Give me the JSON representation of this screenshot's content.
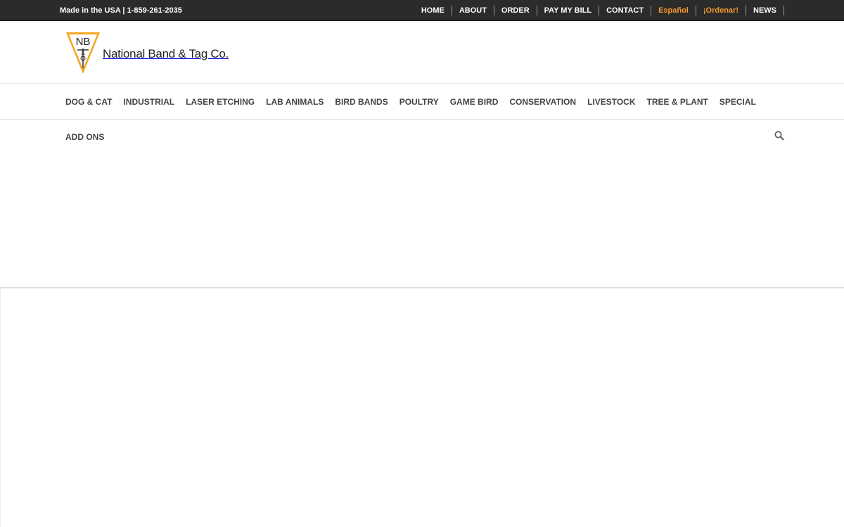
{
  "topbar": {
    "tagline": "Made in the USA | 1-859-261-2035",
    "links": [
      {
        "label": "HOME"
      },
      {
        "label": "ABOUT"
      },
      {
        "label": "ORDER"
      },
      {
        "label": "PAY MY BILL"
      },
      {
        "label": "CONTACT"
      },
      {
        "label": "Español"
      },
      {
        "label": "¡Ordenar!"
      },
      {
        "label": "NEWS"
      }
    ]
  },
  "logo": {
    "monogram_top": "NB",
    "monogram_mid": "&",
    "monogram_bottom": "T",
    "name": "National Band & Tag Co."
  },
  "main_nav": {
    "items": [
      {
        "label": "DOG & CAT"
      },
      {
        "label": "INDUSTRIAL"
      },
      {
        "label": "LASER ETCHING"
      },
      {
        "label": "LAB ANIMALS"
      },
      {
        "label": "BIRD BANDS"
      },
      {
        "label": "POULTRY"
      },
      {
        "label": "GAME BIRD"
      },
      {
        "label": "CONSERVATION"
      },
      {
        "label": "LIVESTOCK"
      },
      {
        "label": "TREE & PLANT"
      },
      {
        "label": "SPECIAL"
      }
    ],
    "overflow_items": [
      {
        "label": "ADD ONS"
      }
    ],
    "search_icon": "search-icon"
  },
  "colors": {
    "topbar_bg": "#2b2b2b",
    "accent": "#f39a31",
    "nav_text": "#444444"
  }
}
